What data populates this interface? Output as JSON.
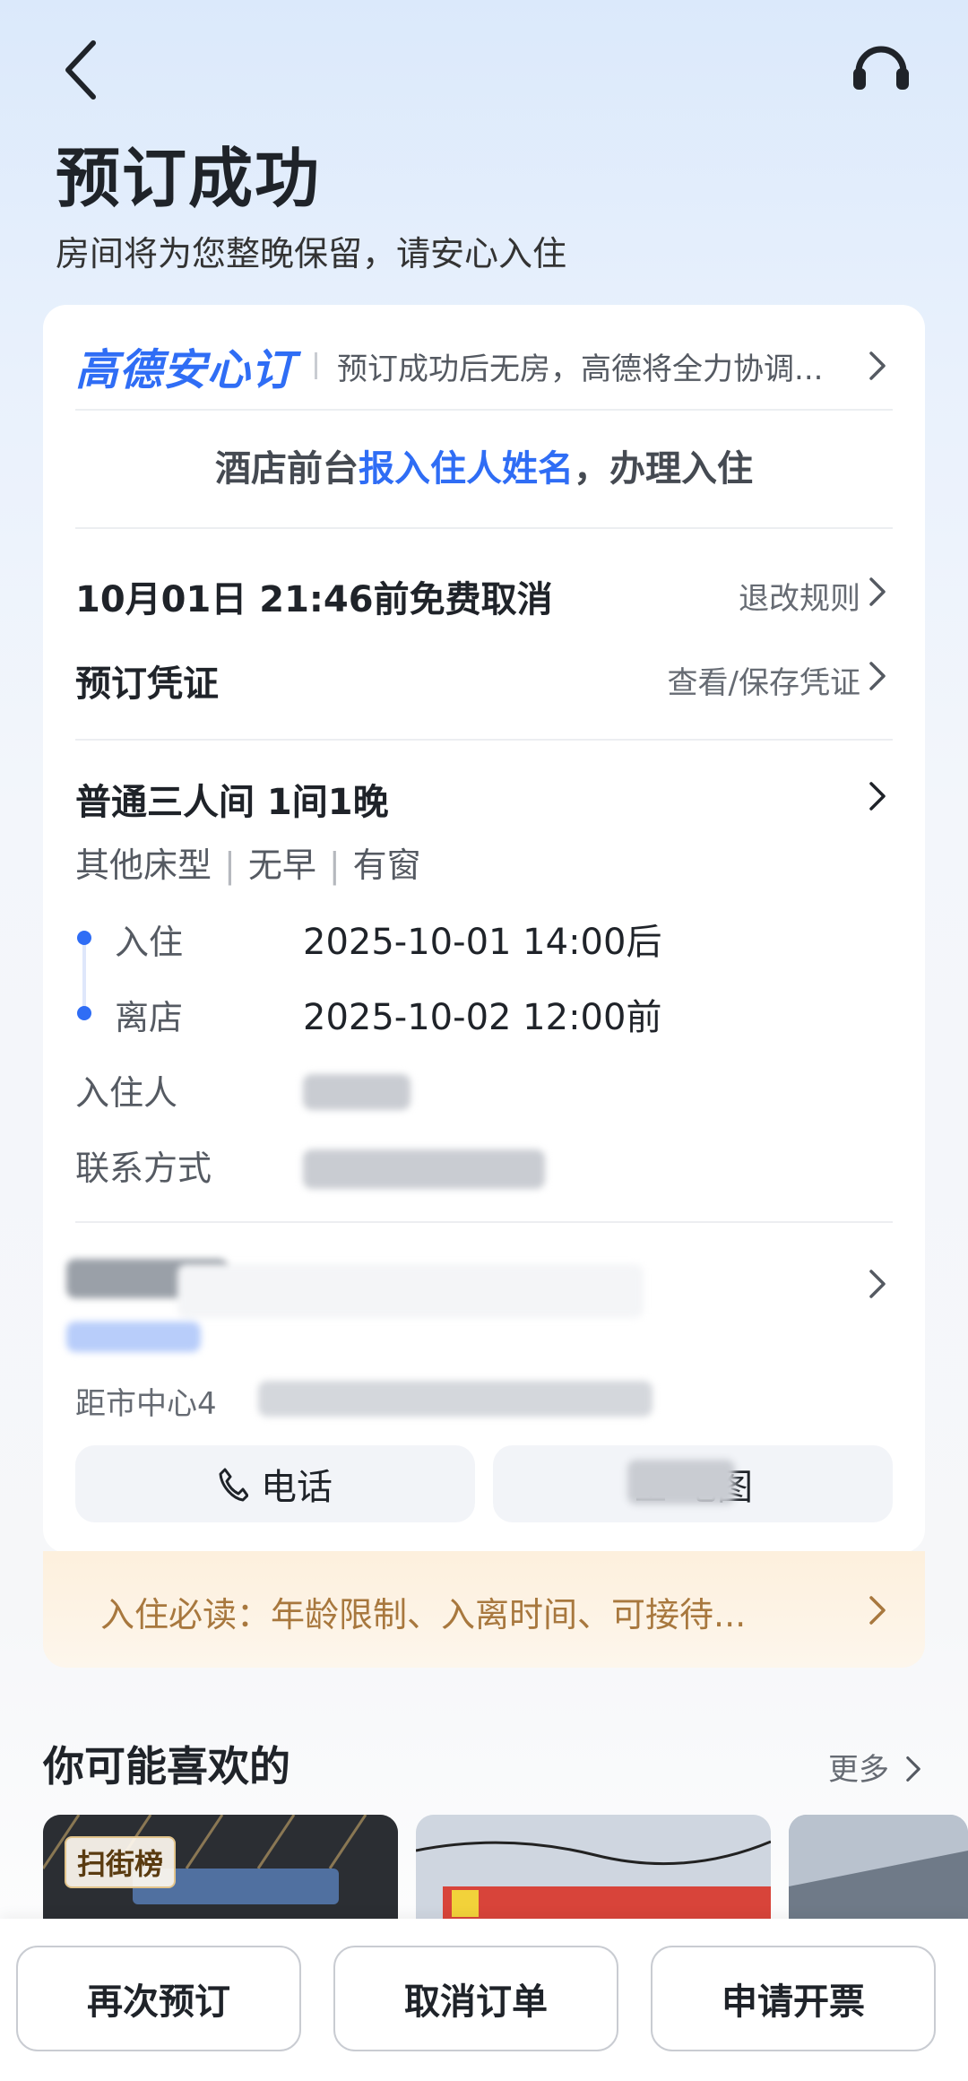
{
  "header": {
    "title": "预订成功",
    "subtitle": "房间将为您整晚保留，请安心入住"
  },
  "guarantee": {
    "brand": "高德安心订",
    "description": "预订成功后无房，高德将全力协调..."
  },
  "checkin_tip": {
    "prefix": "酒店前台",
    "highlight": "报入住人姓名",
    "suffix": "，办理入住"
  },
  "cancellation": {
    "text": "10月01日 21:46前免费取消",
    "link": "退改规则"
  },
  "voucher": {
    "label": "预订凭证",
    "link": "查看/保存凭证"
  },
  "room": {
    "title": "普通三人间 1间1晚",
    "features": [
      "其他床型",
      "无早",
      "有窗"
    ],
    "checkin_label": "入住",
    "checkin_value": "2025-10-01 14:00后",
    "checkout_label": "离店",
    "checkout_value": "2025-10-02 12:00前",
    "guest_label": "入住人",
    "contact_label": "联系方式"
  },
  "hotel": {
    "distance": "距市中心4"
  },
  "actions": {
    "phone": "电话",
    "map": "地图"
  },
  "notice": {
    "text": "入住必读：年龄限制、入离时间、可接待..."
  },
  "recommend": {
    "title": "你可能喜欢的",
    "more": "更多",
    "badge": "扫街榜"
  },
  "bottom_bar": {
    "rebook": "再次预订",
    "cancel": "取消订单",
    "invoice": "申请开票"
  },
  "colors": {
    "accent": "#2f6df5",
    "notice_text": "#a8783e",
    "notice_bg": "#fdf0dd"
  }
}
